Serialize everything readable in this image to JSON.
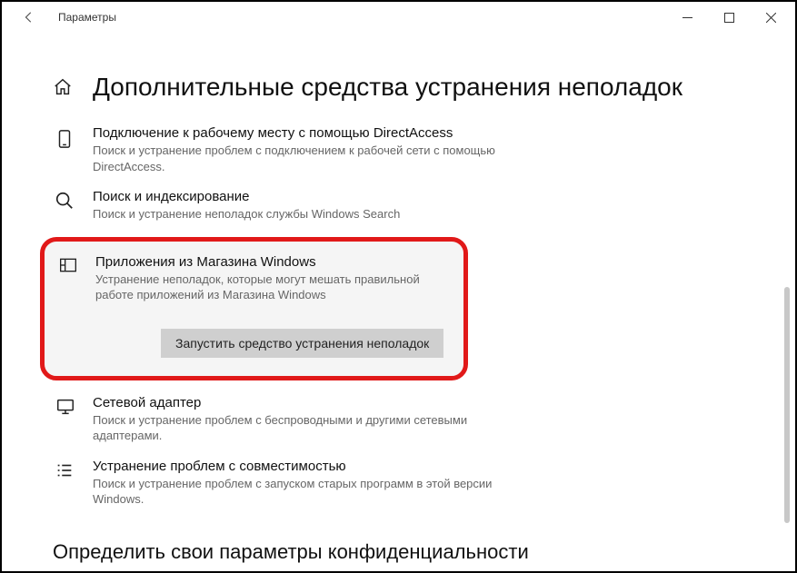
{
  "window": {
    "title": "Параметры"
  },
  "page": {
    "heading": "Дополнительные средства устранения неполадок",
    "section_heading": "Определить свои параметры конфиденциальности"
  },
  "troubleshooters": {
    "direct_access": {
      "title": "Подключение к рабочему месту с помощью DirectAccess",
      "desc": "Поиск и устранение проблем с подключением к рабочей сети с помощью DirectAccess."
    },
    "search": {
      "title": "Поиск и индексирование",
      "desc": "Поиск и устранение неполадок службы Windows Search"
    },
    "store_apps": {
      "title": "Приложения из Магазина Windows",
      "desc": "Устранение неполадок, которые могут мешать правильной работе приложений из Магазина Windows",
      "run_label": "Запустить средство устранения неполадок"
    },
    "network_adapter": {
      "title": "Сетевой адаптер",
      "desc": "Поиск и устранение проблем с беспроводными и другими сетевыми адаптерами."
    },
    "compat": {
      "title": "Устранение проблем с совместимостью",
      "desc": "Поиск и устранение проблем с запуском старых программ в этой версии Windows."
    }
  }
}
